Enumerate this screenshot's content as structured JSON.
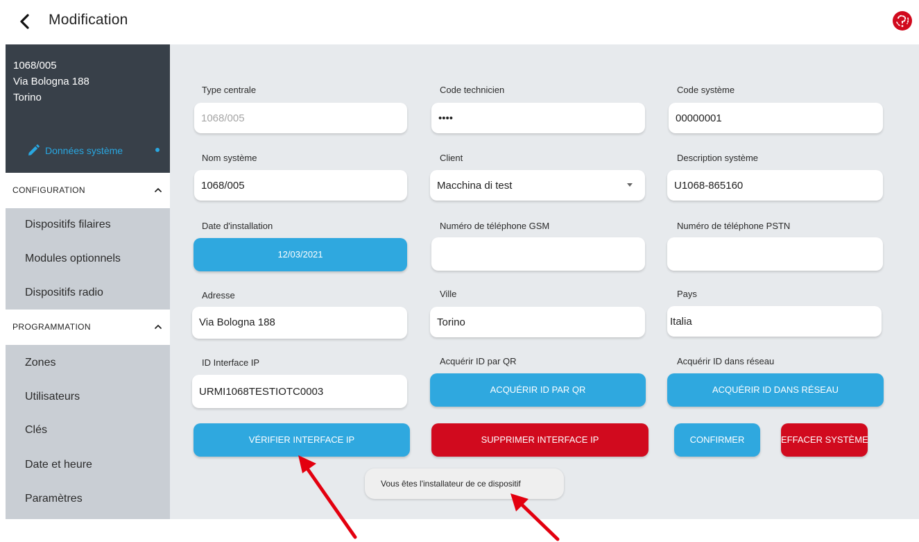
{
  "header": {
    "title": "Modification",
    "back_icon": "chevron-left-icon",
    "logo_icon": "brand-logo-icon",
    "logo_color": "#d10a1e"
  },
  "sidebar": {
    "system": {
      "id": "1068/005",
      "address": "Via Bologna 188",
      "city": "Torino",
      "active_item": "Données système"
    },
    "sections": [
      {
        "label": "CONFIGURATION",
        "items": [
          "Dispositifs filaires",
          "Modules optionnels",
          "Dispositifs radio"
        ]
      },
      {
        "label": "PROGRAMMATION",
        "items": [
          "Zones",
          "Utilisateurs",
          "Clés",
          "Date et heure",
          "Paramètres"
        ]
      }
    ]
  },
  "form": {
    "type_centrale": {
      "label": "Type centrale",
      "value": "1068/005"
    },
    "code_technicien": {
      "label": "Code technicien",
      "value": "••••"
    },
    "code_systeme": {
      "label": "Code système",
      "value": "00000001"
    },
    "nom_systeme": {
      "label": "Nom système",
      "value": "1068/005"
    },
    "client": {
      "label": "Client",
      "value": "Macchina di test"
    },
    "description_systeme": {
      "label": "Description système",
      "value": "U1068-865160"
    },
    "date_installation": {
      "label": "Date d'installation",
      "value": "12/03/2021"
    },
    "tel_gsm": {
      "label": "Numéro de téléphone GSM",
      "value": ""
    },
    "tel_pstn": {
      "label": "Numéro de téléphone PSTN",
      "value": ""
    },
    "adresse": {
      "label": "Adresse",
      "value": "Via Bologna 188"
    },
    "ville": {
      "label": "Ville",
      "value": "Torino"
    },
    "pays": {
      "label": "Pays",
      "value": "Italia"
    },
    "id_interface_ip": {
      "label": "ID Interface IP",
      "value": "URMI1068TESTIOTC0003"
    },
    "acquerir_qr": {
      "label": "Acquérir ID par QR",
      "button": "ACQUÉRIR ID PAR QR"
    },
    "acquerir_reseau": {
      "label": "Acquérir ID dans réseau",
      "button": "ACQUÉRIR ID DANS RÉSEAU"
    }
  },
  "actions": {
    "verifier": "VÉRIFIER INTERFACE IP",
    "supprimer": "SUPPRIMER INTERFACE IP",
    "confirmer": "CONFIRMER",
    "effacer": "EFFACER SYSTÈME"
  },
  "toast": {
    "message": "Vous êtes l'installateur de ce dispositif"
  },
  "colors": {
    "accent_blue": "#2fa8df",
    "danger_red": "#d10a1e",
    "sidebar_dark": "#384049",
    "sidebar_bg": "#c9ced4",
    "content_bg": "#e7eaed",
    "annotation_arrow": "#e3000f"
  }
}
